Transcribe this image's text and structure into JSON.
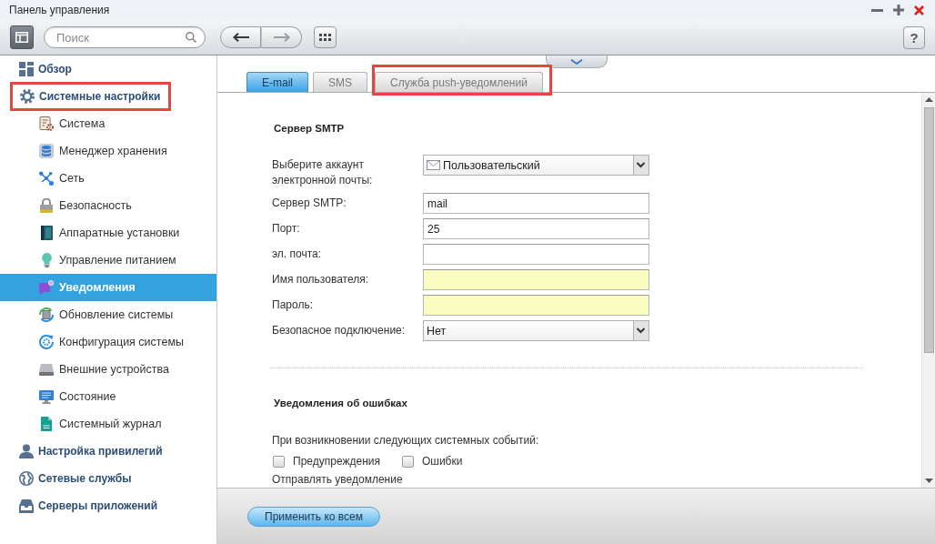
{
  "window": {
    "title": "Панель управления"
  },
  "toolbar": {
    "search": {
      "placeholder": "Поиск"
    },
    "back": {
      "disabled": false
    },
    "forward": {
      "disabled": true
    },
    "help": {
      "label": "?"
    }
  },
  "sidebar": {
    "items": [
      {
        "label": "Обзор",
        "selected": false,
        "highlighted": false
      },
      {
        "label": "Системные настройки",
        "selected": false,
        "highlighted": true,
        "children": [
          {
            "label": "Система",
            "selected": false
          },
          {
            "label": "Менеджер хранения",
            "selected": false
          },
          {
            "label": "Сеть",
            "selected": false
          },
          {
            "label": "Безопасность",
            "selected": false
          },
          {
            "label": "Аппаратные установки",
            "selected": false
          },
          {
            "label": "Управление питанием",
            "selected": false
          },
          {
            "label": "Уведомления",
            "selected": true
          },
          {
            "label": "Обновление системы",
            "selected": false
          },
          {
            "label": "Конфигурация системы",
            "selected": false
          },
          {
            "label": "Внешние устройства",
            "selected": false
          },
          {
            "label": "Состояние",
            "selected": false
          },
          {
            "label": "Системный журнал",
            "selected": false
          }
        ]
      },
      {
        "label": "Настройка привилегий",
        "selected": false,
        "highlighted": false
      },
      {
        "label": "Сетевые службы",
        "selected": false,
        "highlighted": false
      },
      {
        "label": "Серверы приложений",
        "selected": false,
        "highlighted": false
      }
    ]
  },
  "tabs": [
    {
      "label": "E-mail",
      "selected": true,
      "highlighted": false
    },
    {
      "label": "SMS",
      "selected": false,
      "highlighted": false
    },
    {
      "label": "Служба push-уведомлений",
      "selected": false,
      "highlighted": true
    }
  ],
  "smtp_section": {
    "heading": "Сервер SMTP",
    "fields": [
      {
        "kind": "mail-select",
        "label": "Выберите аккаунт электронной почты:",
        "value": "Пользовательский"
      },
      {
        "kind": "text",
        "label": "Сервер SMTP:",
        "value": "mail",
        "required": false
      },
      {
        "kind": "text",
        "label": "Порт:",
        "value": "25",
        "required": false
      },
      {
        "kind": "text",
        "label": "эл. почта:",
        "required": false
      },
      {
        "kind": "text",
        "label": "Имя пользователя:",
        "required": true
      },
      {
        "kind": "text",
        "label": "Пароль:",
        "required": true
      },
      {
        "kind": "select",
        "label": "Безопасное подключение:",
        "value": "Нет"
      }
    ]
  },
  "errors_section": {
    "heading": "Уведомления об ошибках",
    "prompt": "При возникновении следующих системных событий:",
    "options": [
      {
        "label": "Предупреждения",
        "checked": false
      },
      {
        "label": "Ошибки",
        "checked": false
      }
    ],
    "next_label": "Отправлять уведомление"
  },
  "footer": {
    "apply_button": "Применить ко всем"
  }
}
